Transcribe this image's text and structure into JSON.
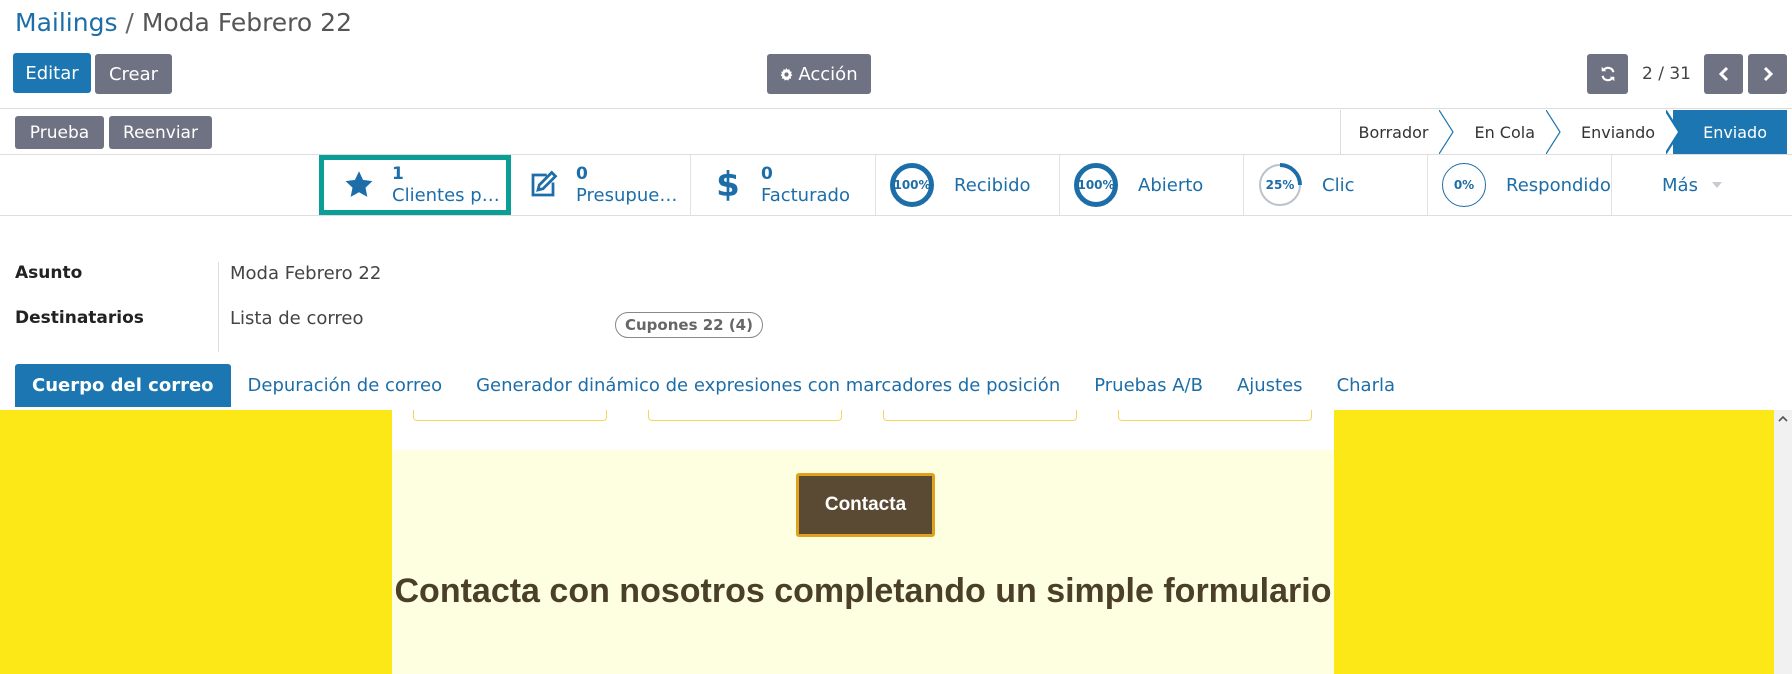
{
  "breadcrumb": {
    "parent": "Mailings",
    "separator": "/",
    "current": "Moda Febrero 22"
  },
  "toolbar": {
    "edit_label": "Editar",
    "create_label": "Crear",
    "action_label": "Acción"
  },
  "pager": {
    "value": "2 / 31"
  },
  "header_buttons": {
    "test_label": "Prueba",
    "resend_label": "Reenviar"
  },
  "status_stages": [
    "Borrador",
    "En Cola",
    "Enviando",
    "Enviado"
  ],
  "status_active": "Enviado",
  "smart_buttons": {
    "customers": {
      "count": "1",
      "label": "Clientes potenciales"
    },
    "quotations": {
      "count": "0",
      "label": "Presupuestos"
    },
    "invoiced": {
      "count": "0",
      "label": "Facturado"
    },
    "received": {
      "percent": "100%",
      "label": "Recibido"
    },
    "opened": {
      "percent": "100%",
      "label": "Abierto"
    },
    "clicked": {
      "percent": "25%",
      "label": "Clic"
    },
    "replied": {
      "percent": "0%",
      "label": "Respondido"
    },
    "more_label": "Más"
  },
  "form": {
    "subject_label": "Asunto",
    "subject_value": "Moda Febrero 22",
    "recipients_label": "Destinatarios",
    "recipients_value": "Lista de correo",
    "mailing_list_tag": "Cupones 22 (4)"
  },
  "tabs": [
    "Cuerpo del correo",
    "Depuración de correo",
    "Generador dinámico de expresiones con marcadores de posición",
    "Pruebas A/B",
    "Ajustes",
    "Charla"
  ],
  "email_body": {
    "button_label": "Contacta",
    "headline": "Contacta con nosotros completando un simple formulario"
  },
  "colors": {
    "primary": "#1b76b1",
    "link": "#1d6ea8",
    "secondary_button": "#6f7283",
    "highlight": "#0b9e96",
    "email_background": "#fbe816",
    "email_button": "#5a4a33"
  },
  "icons": {
    "customers": "star-icon",
    "quotations": "edit-icon",
    "invoiced": "dollar-icon",
    "action": "gear-icon",
    "refresh": "refresh-icon",
    "prev": "chevron-left-icon",
    "next": "chevron-right-icon",
    "more": "caret-down-icon"
  }
}
